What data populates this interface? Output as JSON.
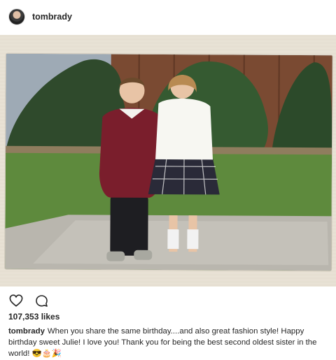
{
  "post": {
    "username": "tombrady",
    "likes": "107,353 likes",
    "caption_user": "tombrady",
    "caption_text": "When you share the same birthday....and also great fashion style! Happy birthday sweet Julie! I love you! Thank you for being the best second oldest sister in the world! 😎🎂🎉"
  },
  "icons": {
    "like": "heart-icon",
    "comment": "comment-icon"
  },
  "colors": {
    "text": "#262626",
    "frame": "#e6e0d3"
  }
}
